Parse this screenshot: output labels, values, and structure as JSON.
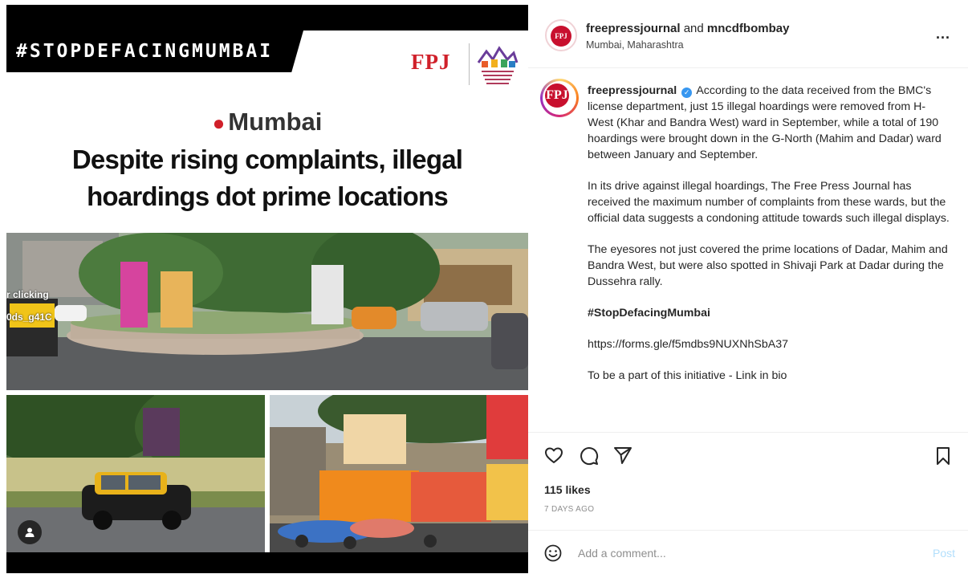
{
  "media": {
    "hashtag_banner": "#STOPDEFACINGMUMBAI",
    "fpj_logo_text": "FPJ",
    "location_label": "Mumbai",
    "headline_line1": "Despite rising complaints, illegal",
    "headline_line2": "hoardings dot prime locations",
    "overlay_line1": "r clicking",
    "overlay_line2": "0ds_g41C"
  },
  "post": {
    "header": {
      "author": "freepressjournal",
      "conjunction": "and",
      "collaborator": "mncdfbombay",
      "location": "Mumbai, Maharashtra",
      "avatar_text": "FPJ",
      "more_label": "..."
    },
    "caption": {
      "username": "freepressjournal",
      "paragraph1": "According to the data received from the BMC's license department, just 15 illegal hoardings were removed from H-West (Khar and Bandra West) ward in September, while a total of 190 hoardings were brought down in the G-North (Mahim and Dadar) ward between January and September.",
      "paragraph2": "In its drive against illegal hoardings, The Free Press Journal has received the maximum number of complaints from these wards, but the official data suggests a condoning attitude towards such illegal displays.",
      "paragraph3": "The eyesores not just covered the prime locations of Dadar, Mahim and Bandra West, but were also spotted in Shivaji Park at Dadar during the Dussehra rally.",
      "hashtag": "#StopDefacingMumbai",
      "link": "https://forms.gle/f5mdbs9NUXNhSbA37",
      "cta": "To be a part of this initiative - Link in bio"
    },
    "likes": "115 likes",
    "time_ago": "7 DAYS AGO",
    "comment": {
      "placeholder": "Add a comment...",
      "value": "",
      "post_label": "Post"
    }
  },
  "icons": {
    "like": "heart-icon",
    "comment": "speech-bubble-icon",
    "share": "paper-plane-icon",
    "save": "bookmark-icon",
    "emoji": "smiley-icon",
    "tags": "user-icon",
    "location": "map-pin-icon"
  },
  "colors": {
    "brand_red": "#d0202a",
    "verified_blue": "#3897f0",
    "post_button_disabled": "#b2dffc",
    "secondary_text": "#8e8e8e"
  }
}
